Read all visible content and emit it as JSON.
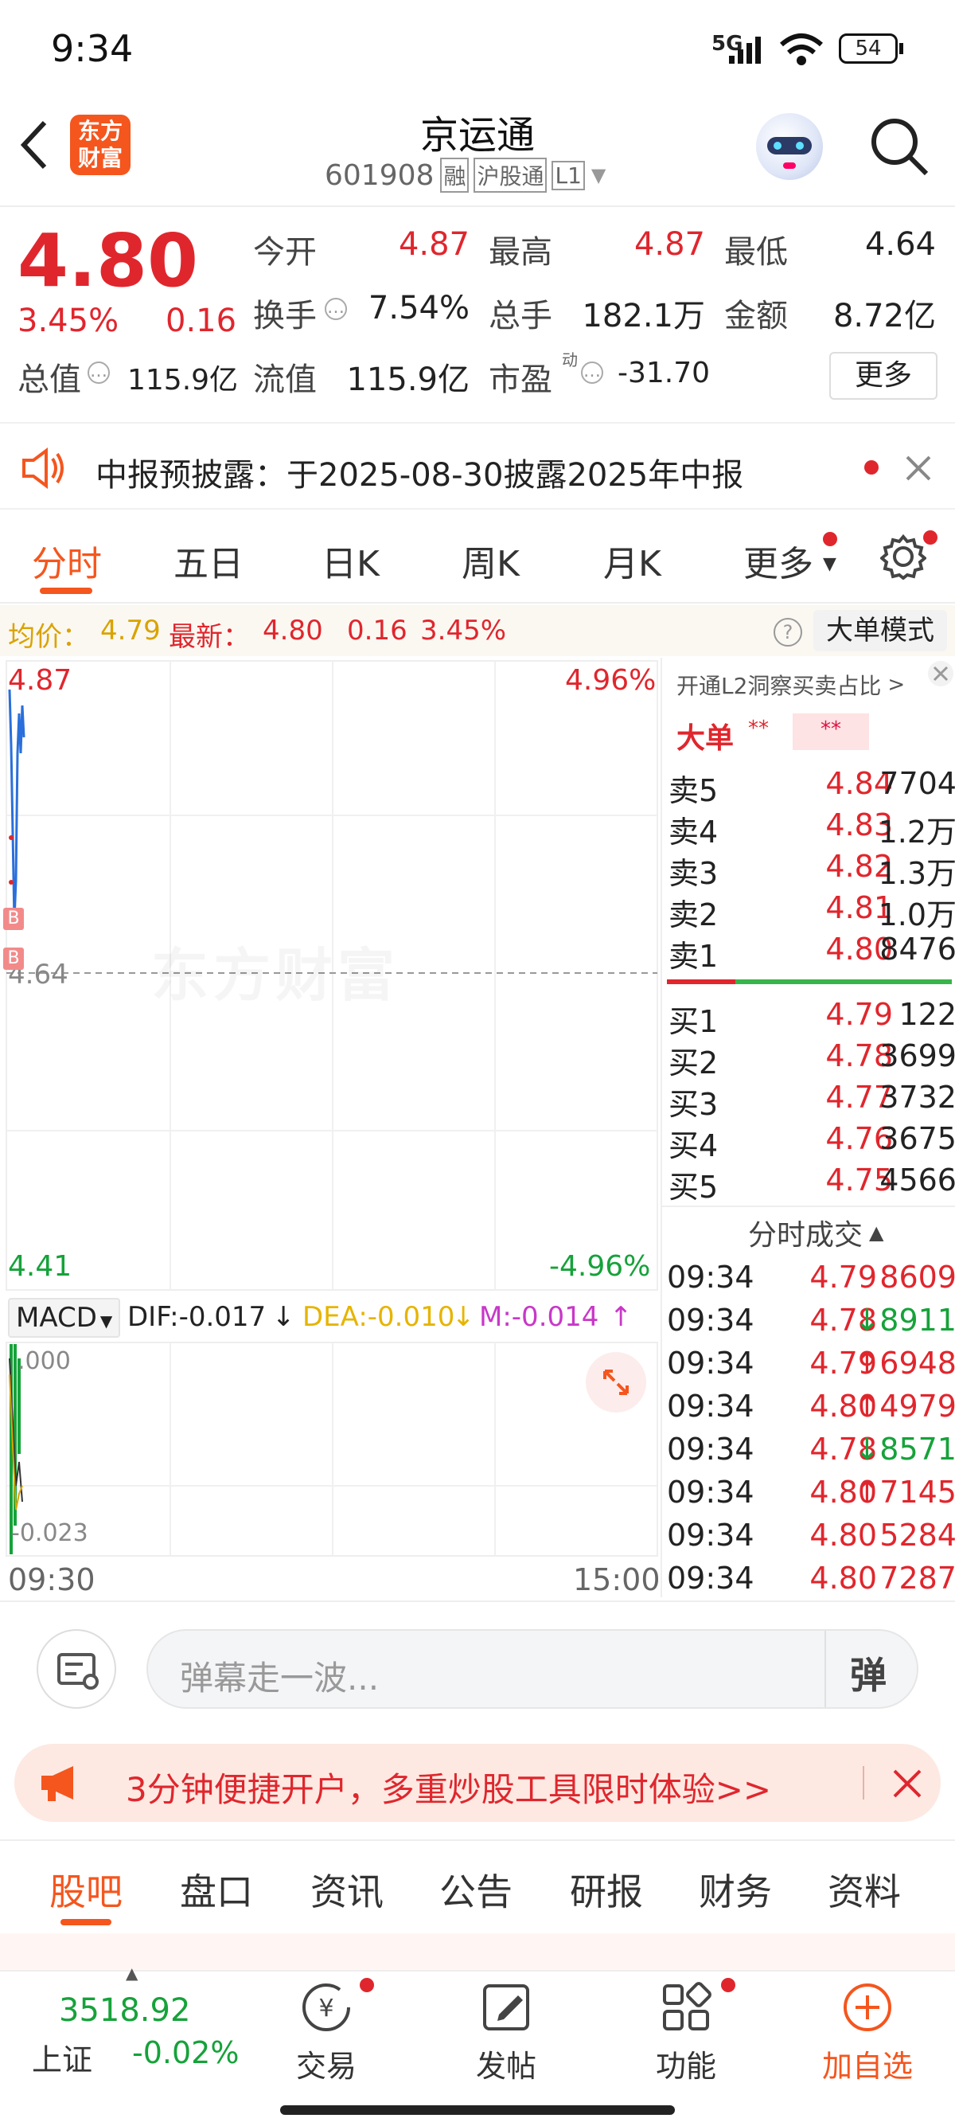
{
  "status_bar": {
    "time": "9:34",
    "network": "5G",
    "battery": "54"
  },
  "header": {
    "logo_text_1": "东方",
    "logo_text_2": "财富",
    "title": "京运通",
    "code": "601908",
    "tags": [
      "融",
      "沪股通",
      "L1"
    ]
  },
  "quote": {
    "price": "4.80",
    "change_pct": "3.45%",
    "change": "0.16",
    "stats": [
      {
        "label": "今开",
        "value": "4.87"
      },
      {
        "label": "最高",
        "value": "4.87"
      },
      {
        "label": "最低",
        "value": "4.64"
      },
      {
        "label": "换手",
        "value": "7.54%"
      },
      {
        "label": "总手",
        "value": "182.1万"
      },
      {
        "label": "金额",
        "value": "8.72亿"
      },
      {
        "label": "总值",
        "value": "115.9亿"
      },
      {
        "label": "流值",
        "value": "115.9亿"
      },
      {
        "label": "市盈",
        "sup": "动",
        "value": "-31.70"
      }
    ],
    "more_label": "更多"
  },
  "notice": {
    "text": "中报预披露：于2025-08-30披露2025年中报"
  },
  "tabs": [
    "分时",
    "五日",
    "日K",
    "周K",
    "月K",
    "更多"
  ],
  "infobar": {
    "avg_label": "均价：",
    "avg_value": "4.79",
    "latest_label": "最新：",
    "latest_value": "4.80",
    "latest_change": "0.16",
    "latest_pct": "3.45%",
    "mode_label": "大单模式"
  },
  "chart": {
    "high_price": "4.87",
    "high_pct": "4.96%",
    "mid_price": "4.64",
    "low_price": "4.41",
    "low_pct": "-4.96%",
    "watermark": "东方财富",
    "marker": "B",
    "macd_label": "MACD",
    "dif": "DIF:-0.017",
    "dea": "DEA:-0.010",
    "m": "M:-0.014",
    "macd_top": ".000",
    "macd_bottom": "-0.023",
    "time_start": "09:30",
    "time_end": "15:00"
  },
  "order_book": {
    "l2_text": "开通L2洞察买卖占比",
    "big_order_label": "大单",
    "big_order_mask": "**",
    "asks": [
      {
        "label": "卖5",
        "price": "4.84",
        "vol": "7704"
      },
      {
        "label": "卖4",
        "price": "4.83",
        "vol": "1.2万"
      },
      {
        "label": "卖3",
        "price": "4.82",
        "vol": "1.3万"
      },
      {
        "label": "卖2",
        "price": "4.81",
        "vol": "1.0万"
      },
      {
        "label": "卖1",
        "price": "4.80",
        "vol": "8476"
      }
    ],
    "bids": [
      {
        "label": "买1",
        "price": "4.79",
        "vol": "122"
      },
      {
        "label": "买2",
        "price": "4.78",
        "vol": "3699"
      },
      {
        "label": "买3",
        "price": "4.77",
        "vol": "3732"
      },
      {
        "label": "买4",
        "price": "4.76",
        "vol": "3675"
      },
      {
        "label": "买5",
        "price": "4.75",
        "vol": "4566"
      }
    ],
    "trades_title": "分时成交",
    "trades": [
      {
        "time": "09:34",
        "price": "4.79",
        "vol": "8609",
        "dir": ""
      },
      {
        "time": "09:34",
        "price": "4.78",
        "vol": "8911",
        "dir": "↓"
      },
      {
        "time": "09:34",
        "price": "4.79",
        "vol": "6948",
        "dir": "↑"
      },
      {
        "time": "09:34",
        "price": "4.80",
        "vol": "4979",
        "dir": "↑"
      },
      {
        "time": "09:34",
        "price": "4.78",
        "vol": "8571",
        "dir": "↓"
      },
      {
        "time": "09:34",
        "price": "4.80",
        "vol": "7145",
        "dir": "↑"
      },
      {
        "time": "09:34",
        "price": "4.80",
        "vol": "5284",
        "dir": ""
      },
      {
        "time": "09:34",
        "price": "4.80",
        "vol": "7287",
        "dir": ""
      }
    ]
  },
  "danmu": {
    "placeholder": "弹幕走一波...",
    "button_char": "弹"
  },
  "promo": {
    "text": "3分钟便捷开户，多重炒股工具限时体验>>"
  },
  "bottom_tabs": [
    "股吧",
    "盘口",
    "资讯",
    "公告",
    "研报",
    "财务",
    "资料"
  ],
  "toolbar": {
    "index_value": "3518.92",
    "index_name": "上证",
    "index_change": "-0.02%",
    "items": [
      "交易",
      "发帖",
      "功能",
      "加自选"
    ]
  }
}
